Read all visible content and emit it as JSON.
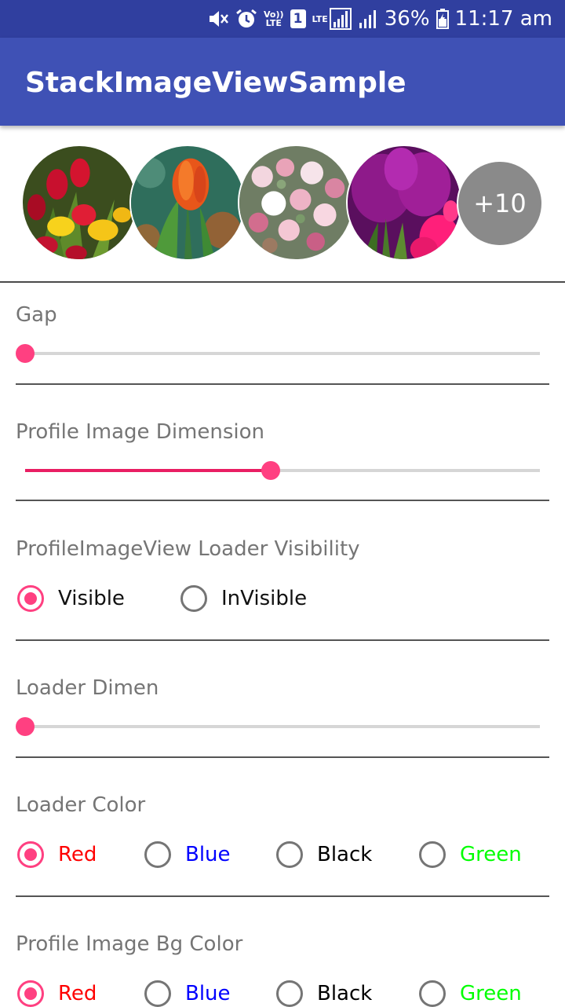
{
  "status_bar": {
    "lte_label": "LTE",
    "volte_top": "Vo))",
    "volte_bottom": "LTE",
    "sim_number": "1",
    "battery": "36%",
    "time": "11:17 am",
    "icons": [
      "mute-icon",
      "alarm-icon",
      "volte-icon",
      "sim-icon",
      "lte-signal-icon",
      "signal-icon",
      "battery-icon"
    ]
  },
  "app_bar": {
    "title": "StackImageViewSample"
  },
  "stack": {
    "images": [
      "red-yellow-tulips",
      "orange-tulip",
      "pink-rose-bouquet",
      "purple-tulips"
    ],
    "more_count": "+10"
  },
  "gap": {
    "label": "Gap",
    "value_fraction": 0.0
  },
  "profile_dimension": {
    "label": "Profile Image Dimension",
    "value_fraction": 0.477
  },
  "loader_visibility": {
    "label": "ProfileImageView Loader Visibility",
    "options": [
      {
        "label": "Visible",
        "selected": true
      },
      {
        "label": "InVisible",
        "selected": false
      }
    ]
  },
  "loader_dimen": {
    "label": "Loader Dimen",
    "value_fraction": 0.0
  },
  "loader_color": {
    "label": "Loader Color",
    "options": [
      {
        "label": "Red",
        "color": "#ff0000",
        "selected": true
      },
      {
        "label": "Blue",
        "color": "#0000ff",
        "selected": false
      },
      {
        "label": "Black",
        "color": "#000000",
        "selected": false
      },
      {
        "label": "Green",
        "color": "#00ff00",
        "selected": false
      }
    ]
  },
  "bg_color": {
    "label": "Profile Image Bg Color",
    "options": [
      {
        "label": "Red",
        "color": "#ff0000",
        "selected": true
      },
      {
        "label": "Blue",
        "color": "#0000ff",
        "selected": false
      },
      {
        "label": "Black",
        "color": "#000000",
        "selected": false
      },
      {
        "label": "Green",
        "color": "#00ff00",
        "selected": false
      }
    ]
  },
  "colors": {
    "primary": "#3F51B5",
    "primary_dark": "#303F9F",
    "accent": "#FF4081"
  }
}
